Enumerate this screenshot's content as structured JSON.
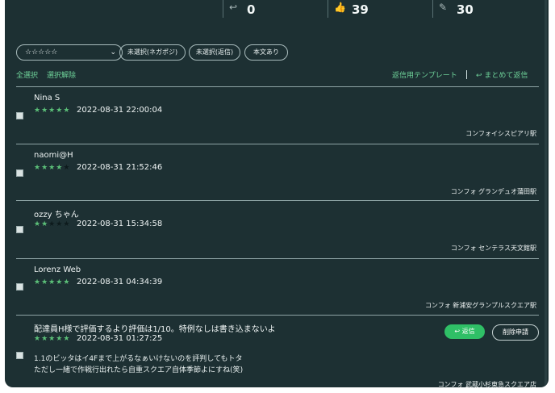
{
  "stats": [
    {
      "icon": "reply-count-icon",
      "glyph": "↩",
      "value": "0"
    },
    {
      "icon": "thumbs-up-icon",
      "glyph": "👍",
      "value": "39"
    },
    {
      "icon": "edit-icon",
      "glyph": "✎",
      "value": "30"
    }
  ],
  "filters": {
    "rating_select": "☆☆☆☆☆",
    "chips": [
      "未選択(ネガポジ)",
      "未選択(返信)",
      "本文あり"
    ]
  },
  "toolbar": {
    "select_all": "全選択",
    "deselect_all": "選択解除",
    "template": "返信用テンプレート",
    "separator": "|",
    "bulk_reply": "まとめて返信"
  },
  "reviews": [
    {
      "name": "Nina S",
      "rating": 5,
      "stars": "★★★★★",
      "date": "2022-08-31 22:00:04",
      "shop": "コンフォイシスピアリ駅"
    },
    {
      "name": "naomi@H",
      "rating": 4,
      "stars": "★★★★★",
      "date": "2022-08-31 21:52:46",
      "shop": "コンフォ グランデュオ蒲田駅"
    },
    {
      "name": "ozzy ちゃん",
      "rating": 2,
      "stars": "★★★★★",
      "date": "2022-08-31 15:34:58",
      "shop": "コンフォ センテラス天文館駅"
    },
    {
      "name": "Lorenz Web",
      "rating": 5,
      "stars": "★★★★★",
      "date": "2022-08-31 04:34:39",
      "shop": "コンフォ 新浦安グランプルスクエア駅"
    },
    {
      "name": "配達員H様で評価するより評価は1/10。特例なしは書き込まないよ",
      "rating": 5,
      "stars": "★★★★★",
      "date": "2022-08-31 01:27:25",
      "shop": "コンフォ 武蔵小杉東急スクエア店",
      "body": [
        "1.1のビッタはイ4Fまで上がるなぁいけないのを評判してもトタ",
        "ただし一緒で作戦行出れたら自重スクエア自体季節よにすね(笑)"
      ],
      "reply_label": "返信",
      "delete_label": "削除申請"
    }
  ],
  "colors": {
    "panel": "#1d3033",
    "accent_green": "#6fd39a",
    "star_filled": "#5bbf78",
    "star_empty": "#0d1a1c",
    "reply_button": "#2fbf66"
  }
}
